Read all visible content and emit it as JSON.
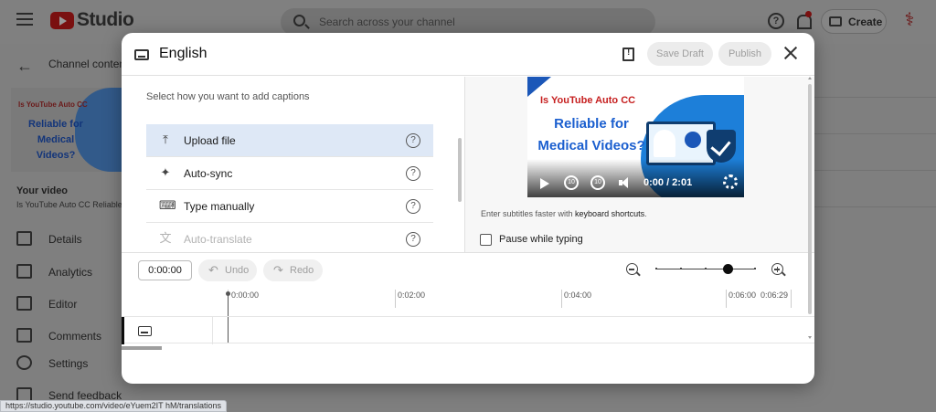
{
  "app": {
    "logo_text": "Studio",
    "search_placeholder": "Search across your channel",
    "create_label": "Create",
    "channel_content_label": "Channel content",
    "thumbnail": {
      "tag": "Is YouTube Auto CC",
      "headline": "Reliable for Medical Videos?"
    },
    "your_video_label": "Your video",
    "your_video_title": "Is YouTube Auto CC Reliable",
    "nav": [
      {
        "label": "Details",
        "icon": "pencil-icon"
      },
      {
        "label": "Analytics",
        "icon": "analytics-icon"
      },
      {
        "label": "Editor",
        "icon": "editor-icon"
      },
      {
        "label": "Comments",
        "icon": "comments-icon"
      },
      {
        "label": "Settings",
        "icon": "gear-icon"
      },
      {
        "label": "Send feedback",
        "icon": "feedback-icon"
      }
    ]
  },
  "status_url": "https://studio.youtube.com/video/eYuem2IT hM/translations",
  "modal": {
    "title": "English",
    "save_draft_label": "Save Draft",
    "publish_label": "Publish",
    "heading": "Select how you want to add captions",
    "options": [
      {
        "label": "Upload file",
        "icon": "upload-icon",
        "glyph": "⤒",
        "selected": true,
        "disabled": false
      },
      {
        "label": "Auto-sync",
        "icon": "sparkle-icon",
        "glyph": "✦",
        "selected": false,
        "disabled": false
      },
      {
        "label": "Type manually",
        "icon": "keyboard-icon",
        "glyph": "⌨",
        "selected": false,
        "disabled": false
      },
      {
        "label": "Auto-translate",
        "icon": "translate-icon",
        "glyph": "文",
        "selected": false,
        "disabled": true
      }
    ],
    "help_glyph": "?",
    "video": {
      "tag": "Is YouTube Auto CC",
      "headline": "Reliable for Medical Videos?",
      "time": "0:00 / 2:01",
      "rewind_label": "10",
      "forward_label": "10"
    },
    "hint_prefix": "Enter subtitles faster with ",
    "hint_link": "keyboard shortcuts",
    "hint_suffix": ".",
    "pause_label": "Pause while typing",
    "pause_checked": false,
    "timecode": "0:00:00",
    "undo_label": "Undo",
    "redo_label": "Redo",
    "zoom_level": 0.72,
    "ruler": [
      "0:00:00",
      "0:02:00",
      "0:04:00",
      "0:06:00",
      "0:06:29"
    ]
  },
  "colors": {
    "selected_option": "#dee8f6",
    "accent_blue": "#1b5fcf",
    "accent_red": "#c61f1f"
  }
}
